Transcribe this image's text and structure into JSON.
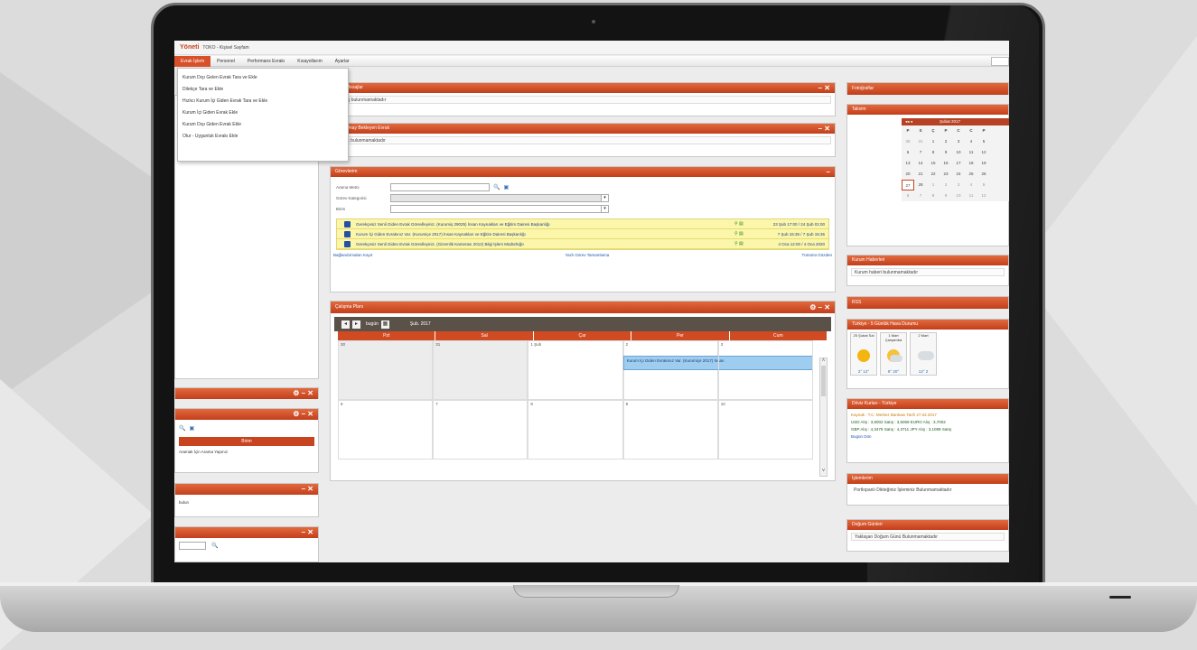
{
  "app": {
    "logo": "Yöneti",
    "title": "TOKO - Kişisel Sayfam"
  },
  "menu": {
    "items": [
      "Evrak İşlem",
      "Personel",
      "Performans Evrakı",
      "Kısayollarım",
      "Ayarlar"
    ]
  },
  "dropdown": {
    "items": [
      "Kurum Dışı Gelen Evrak Tara ve Ekle",
      "Dilekçe Tara ve Ekle",
      "Hızlıcı Kurum İçi Giden Evrak Tara ve Ekle",
      "Kurum İçi Giden Evrak Ekle",
      "Kurum Dışı Giden Evrak Ekle",
      "Olur - Uygunluk Evrakı Ekle"
    ]
  },
  "panels": {
    "messages": {
      "title": "Mesajlar",
      "body": "Mesaj bulunmamaktadır"
    },
    "pending": {
      "title": "Onay Bekleyen Evrak",
      "body": "Evrak bulunmamaktadır"
    },
    "tasks": {
      "title": "Görevlerim",
      "labels": {
        "search": "Arama Metni",
        "category": "Görev Kategorisi",
        "unit": "Birim"
      },
      "rows": [
        {
          "title": "Gerekçesiz Senli Giden Evrak Görevlleyiniz. (Kurumiş 29025) İnsan Kaynakları ve Eğitim Dairesi Başkanlığı",
          "date": "23 Şub 17:00 / 24 Şub 01:00"
        },
        {
          "title": "Kurum İçi Giden Evrakınız Var. (Kurumiçe 2017) İnsan Kaynakları ve Eğitim Dairesi Başkanlığı",
          "date": "7 Şub 15:35 / 7 Şub 15:36"
        },
        {
          "title": "Gerekçesiz Senli Giden Evrak Görevlleyiniz. (Gizemlik Kamerası 2012) Bilgi İşlem Müdürlüğü",
          "date": "4 Oca 12:00 / 4 Oca 2020"
        }
      ],
      "footer": {
        "left": "Bağlandırmaları Kayıt",
        "center": "Yazlı Görev Tamamlama",
        "right": "Tümünü Gözden"
      }
    },
    "plan": {
      "title": "Çalışma Planı",
      "today": "bugün",
      "month": "Şub. 2017",
      "days": [
        "Pzt",
        "Sal",
        "Çar",
        "Per",
        "Cum"
      ],
      "row1": [
        "30",
        "31",
        "1 Şub",
        "2",
        "3"
      ],
      "row2": [
        "6",
        "7",
        "8",
        "9",
        "10"
      ],
      "event": "Kurum İçi Giden Evrakınız Var. (Kurumiçe 2017) İnsan"
    },
    "photos": {
      "title": "Fotoğraflar"
    },
    "calendar": {
      "title": "Takvim",
      "month": "Şubat 2017",
      "week": [
        "P",
        "S",
        "Ç",
        "P",
        "C",
        "C",
        "P"
      ],
      "days": [
        "30",
        "31",
        "1",
        "2",
        "3",
        "4",
        "5",
        "6",
        "7",
        "8",
        "9",
        "10",
        "11",
        "12",
        "13",
        "14",
        "15",
        "16",
        "17",
        "18",
        "19",
        "20",
        "21",
        "22",
        "23",
        "24",
        "25",
        "26",
        "27",
        "28",
        "1",
        "2",
        "3",
        "4",
        "5",
        "6",
        "7",
        "8",
        "9",
        "10",
        "11",
        "12"
      ]
    },
    "news": {
      "title": "Kurum Haberleri",
      "body": "Kurum haberi bulunmamaktadır"
    },
    "rss": {
      "title": "RSS"
    },
    "weather": {
      "title": "Türkiye - 5 Günlük Hava Durumu",
      "days": [
        "25 Şubat Sal",
        "1 Mart Çarşamba",
        "2 Mart"
      ],
      "temps": [
        "2° 12°",
        "9° 20°",
        "12° 2"
      ]
    },
    "currency": {
      "title": "Döviz Kurları - Türkiye",
      "lines": [
        "Kaynak : T.C. Merkez Bankası  Tarih 27.02.2017",
        "USD Alış : 3,5002 Satış : 3,5069  EURO Alış : 3,7002",
        "GBP Alış : 4,3479 Satış : 4,3711  JPY Alış : 3,1089 Satış"
      ],
      "links": "Bugün  Dün"
    },
    "tasks2": {
      "title": "İşlemlerim",
      "body": "Portlopanlı Dikteğiniz İşleminiz Bulunmamaktadır"
    },
    "birthdays": {
      "title": "Doğum Günleri",
      "body": "Yaklaşan Doğum Günü Bulunmamaktadır"
    },
    "left": {
      "col": "Birim",
      "hint": "Aramak İçin Arama Yapınız",
      "other": "bulun"
    }
  }
}
